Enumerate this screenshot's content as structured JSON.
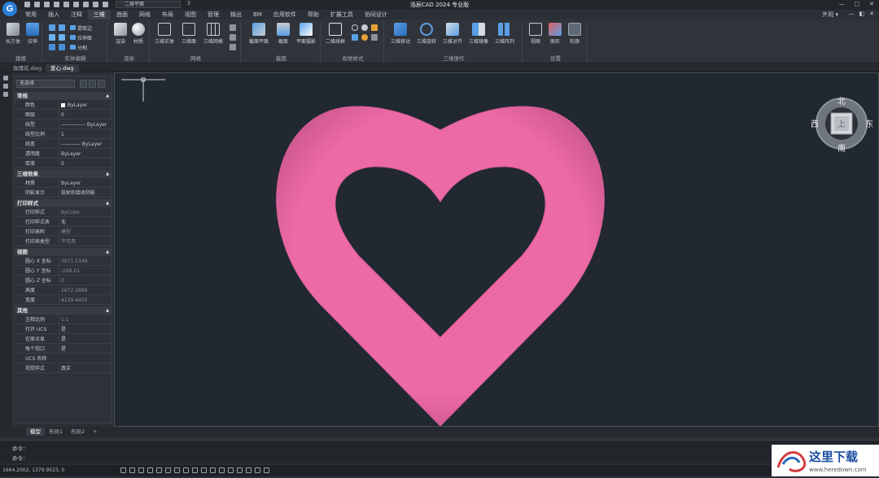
{
  "app": {
    "logo_letter": "G",
    "title": "浩辰CAD 2024 专业版",
    "view_selector": "二维平面",
    "view_selector_arrow": "3",
    "window_controls": [
      "—",
      "□",
      "✕"
    ]
  },
  "menu": {
    "items": [
      "常用",
      "插入",
      "注释",
      "三维",
      "曲面",
      "网格",
      "布局",
      "视图",
      "管理",
      "输出",
      "BM",
      "应用软件",
      "帮助",
      "扩展工具",
      "协同设计"
    ],
    "active_index": 3,
    "appearance": "外观",
    "appearance_arrow": "▾",
    "right_controls": [
      "—",
      "◧",
      "✕"
    ]
  },
  "ribbon": {
    "groups": [
      {
        "name": "建模"
      },
      {
        "name": "实体编辑"
      },
      {
        "name": "渲染"
      },
      {
        "name": "网格"
      },
      {
        "name": "截面"
      },
      {
        "name": "视觉样式"
      },
      {
        "name": "三维操作"
      },
      {
        "name": "设置"
      }
    ],
    "tools": {
      "box": "长方体",
      "extrude": "拉伸",
      "extract_edge": "提取边",
      "presspull": "拉伸面",
      "separate": "分割",
      "render": "渲染",
      "material": "材质",
      "mesh_solid": "三维实体",
      "mesh_surface": "三维面",
      "mesh_grid": "三维网格",
      "section_plane": "截面平面",
      "section": "截面",
      "flatshot": "平面摄影",
      "wireframe2d": "二维线框",
      "move3d": "三维移动",
      "rotate3d": "三维旋转",
      "align3d": "三维对齐",
      "mirror3d": "三维镜像",
      "array3d": "三维阵列",
      "view": "视图",
      "shape": "图形",
      "wheel": "轮廓"
    }
  },
  "doc_tabs": [
    {
      "label": "玫瑰花.dwg",
      "active": false
    },
    {
      "label": "爱心.dwg",
      "active": true
    }
  ],
  "properties": {
    "selection": "无选择",
    "sections": [
      {
        "title": "常规",
        "rows": [
          {
            "key": "颜色",
            "value": "ByLayer",
            "swatch": true
          },
          {
            "key": "图层",
            "value": "0"
          },
          {
            "key": "线型",
            "value": "————— ByLayer"
          },
          {
            "key": "线型比例",
            "value": "1"
          },
          {
            "key": "线宽",
            "value": "———— ByLayer"
          },
          {
            "key": "透明度",
            "value": "ByLayer"
          },
          {
            "key": "厚度",
            "value": "0"
          }
        ]
      },
      {
        "title": "三维效果",
        "rows": [
          {
            "key": "材质",
            "value": "ByLayer"
          },
          {
            "key": "阴影显示",
            "value": "投射和接收阴影"
          }
        ]
      },
      {
        "title": "打印样式",
        "rows": [
          {
            "key": "打印样式",
            "value": "ByColor",
            "dim": true
          },
          {
            "key": "打印样式表",
            "value": "无"
          },
          {
            "key": "打印表附",
            "value": "模型",
            "dim": true
          },
          {
            "key": "打印表类型",
            "value": "不可用",
            "dim": true
          }
        ]
      },
      {
        "title": "视图",
        "rows": [
          {
            "key": "圆心 X 坐标",
            "value": "3071.5348",
            "dim": true
          },
          {
            "key": "圆心 Y 坐标",
            "value": "-269.01",
            "dim": true
          },
          {
            "key": "圆心 Z 坐标",
            "value": "0",
            "dim": true
          },
          {
            "key": "高度",
            "value": "1672.2899",
            "dim": true
          },
          {
            "key": "宽度",
            "value": "4139.4405",
            "dim": true
          }
        ]
      },
      {
        "title": "其他",
        "rows": [
          {
            "key": "注释比例",
            "value": "1:1",
            "dim": true
          },
          {
            "key": "打开 UCS",
            "value": "是"
          },
          {
            "key": "在原点显",
            "value": "是"
          },
          {
            "key": "每个视口",
            "value": "是"
          },
          {
            "key": "UCS 名称",
            "value": ""
          },
          {
            "key": "视觉样式",
            "value": "真实"
          }
        ]
      }
    ]
  },
  "viewcube": {
    "north": "北",
    "south": "南",
    "east": "东",
    "west": "西",
    "top": "上"
  },
  "layout_tabs": [
    {
      "label": "模型",
      "active": true
    },
    {
      "label": "布局1",
      "active": false
    },
    {
      "label": "布局2",
      "active": false
    },
    {
      "label": "+",
      "active": false
    }
  ],
  "command": {
    "line1": "命令：",
    "line2": "命令："
  },
  "status": {
    "coords": "1664.2002, 1379.9523, 0"
  },
  "colors": {
    "heart": "#f06aa8",
    "canvas": "#212830",
    "accent": "#2a7fd8"
  },
  "watermark": {
    "text": "这里下载",
    "url": "www.heredown.com"
  }
}
